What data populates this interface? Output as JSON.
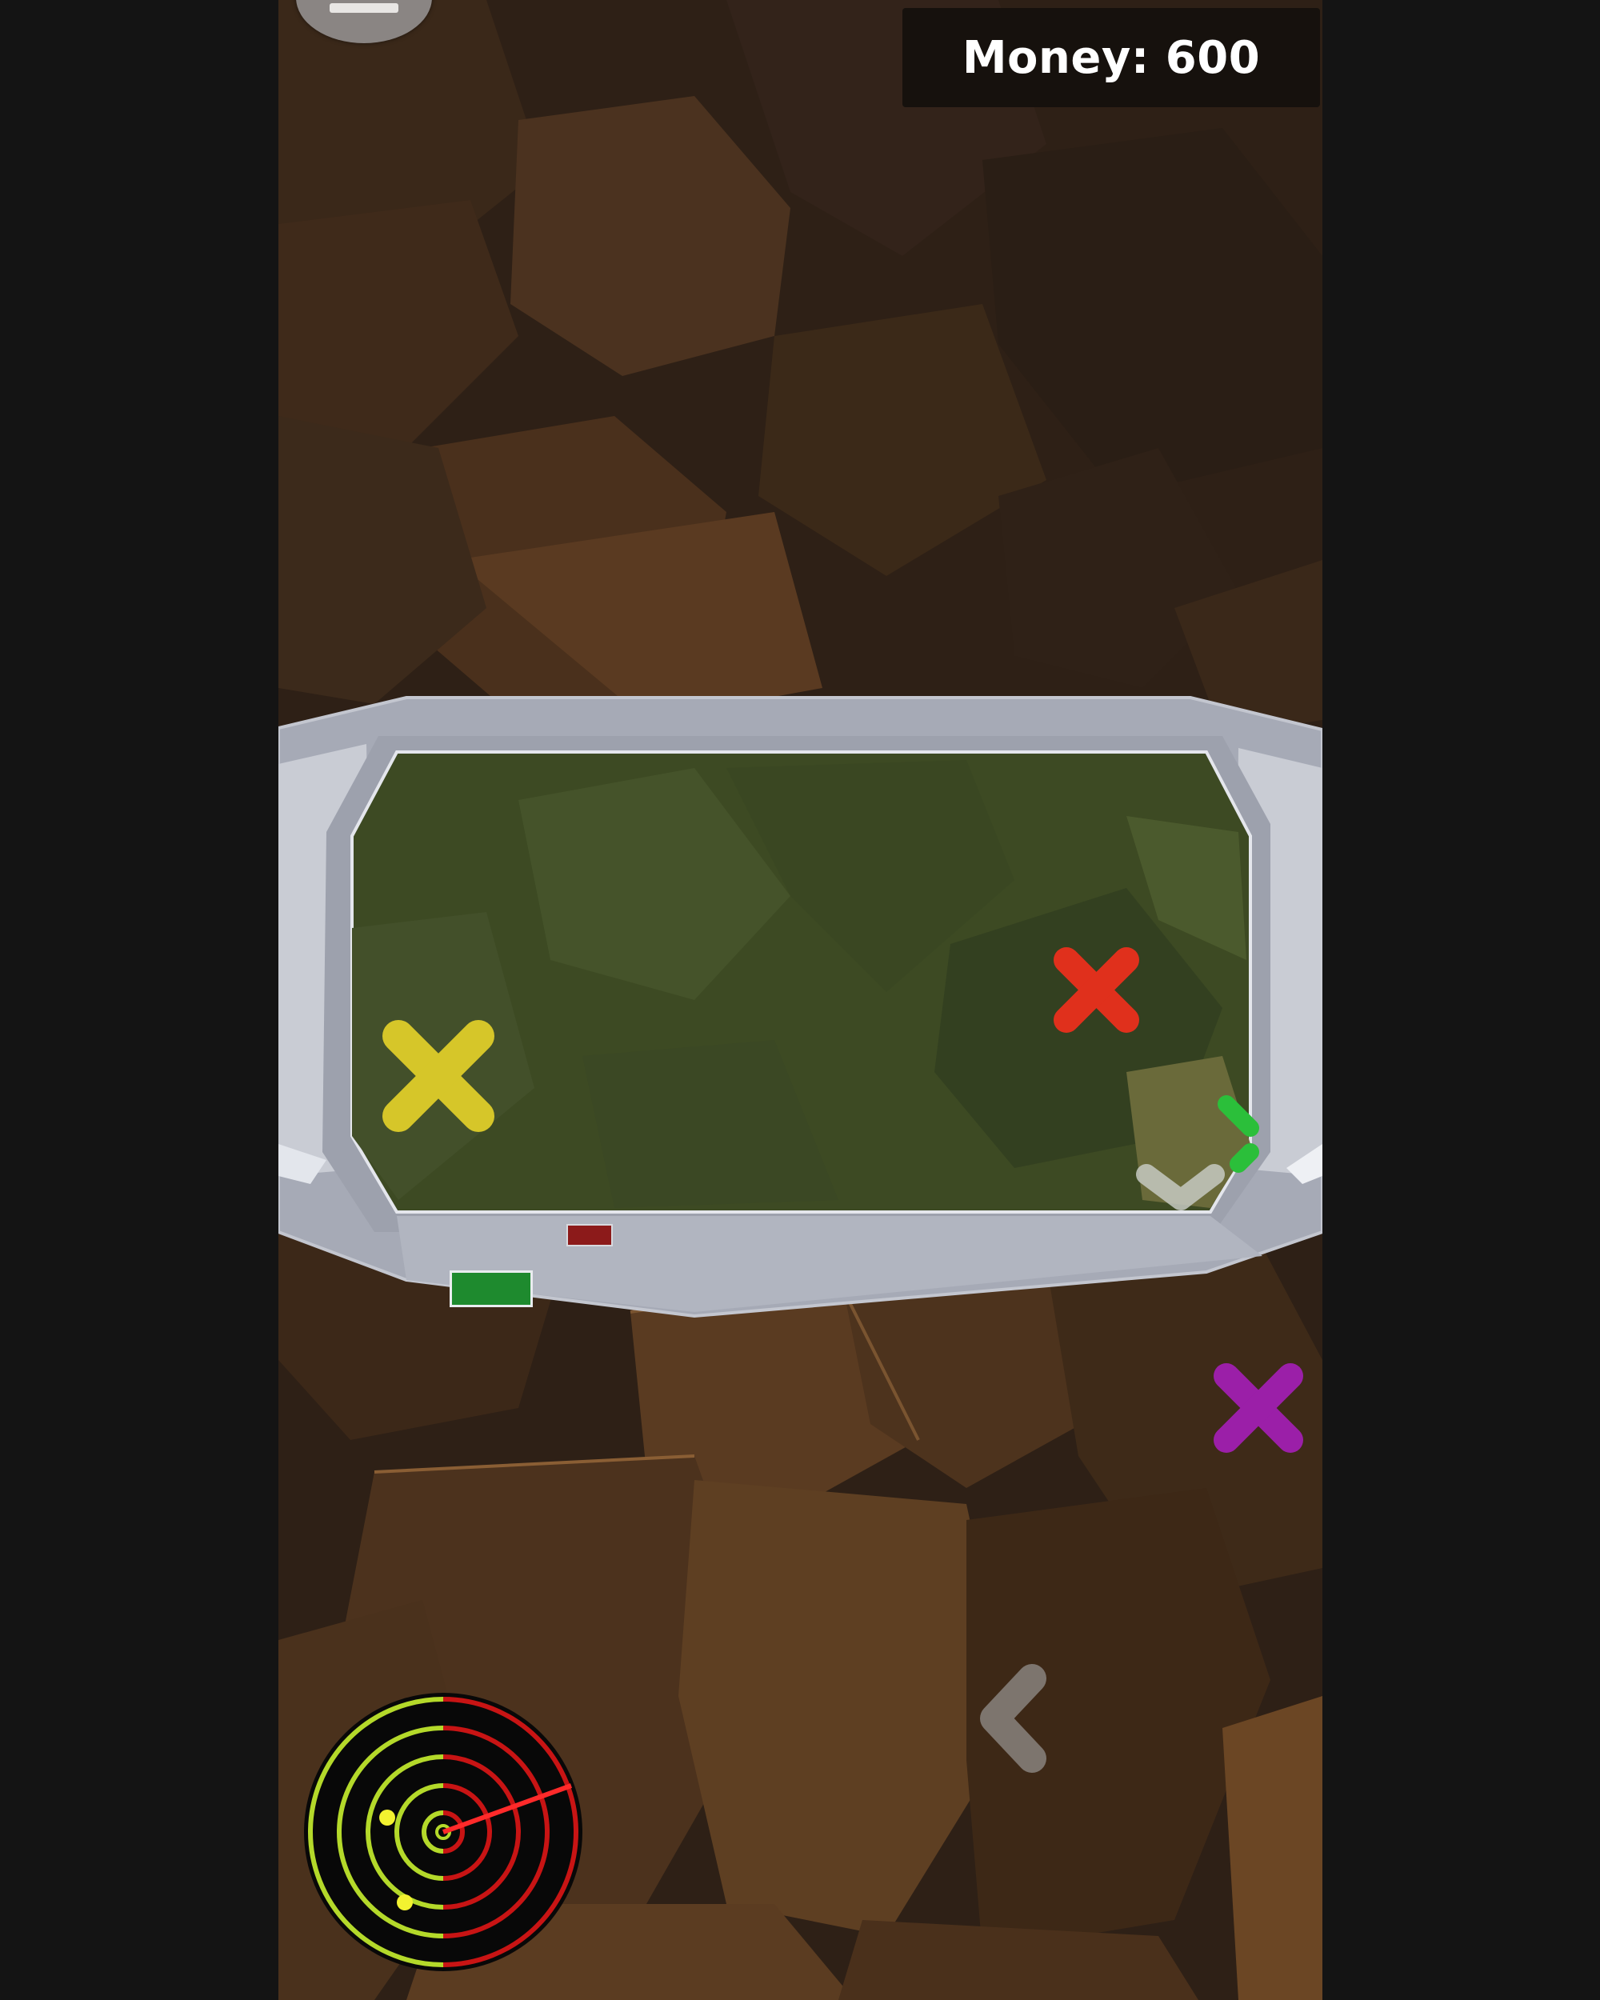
{
  "hud": {
    "money_label": "Money: 600"
  },
  "radar": {
    "sweep_color": "#ff2a2a",
    "scanned_color": "#b4d92a",
    "unscanned_color": "#c81414",
    "blip_color": "#f2f230"
  },
  "targets": [
    {
      "name": "yellow-target-marker",
      "color": "#d6c629"
    },
    {
      "name": "red-target-marker",
      "color": "#e0301c"
    },
    {
      "name": "purple-target-marker",
      "color": "#9b1fa8"
    }
  ],
  "cockpit": {
    "frame_color": "#a9adb8",
    "green_indicator_color": "#1e8a2e",
    "red_indicator_color": "#8c1a1a"
  },
  "icons": {
    "pause": "pause-icon",
    "left_arrow": "chevron-left-icon",
    "down_arrow": "chevron-down-icon"
  }
}
